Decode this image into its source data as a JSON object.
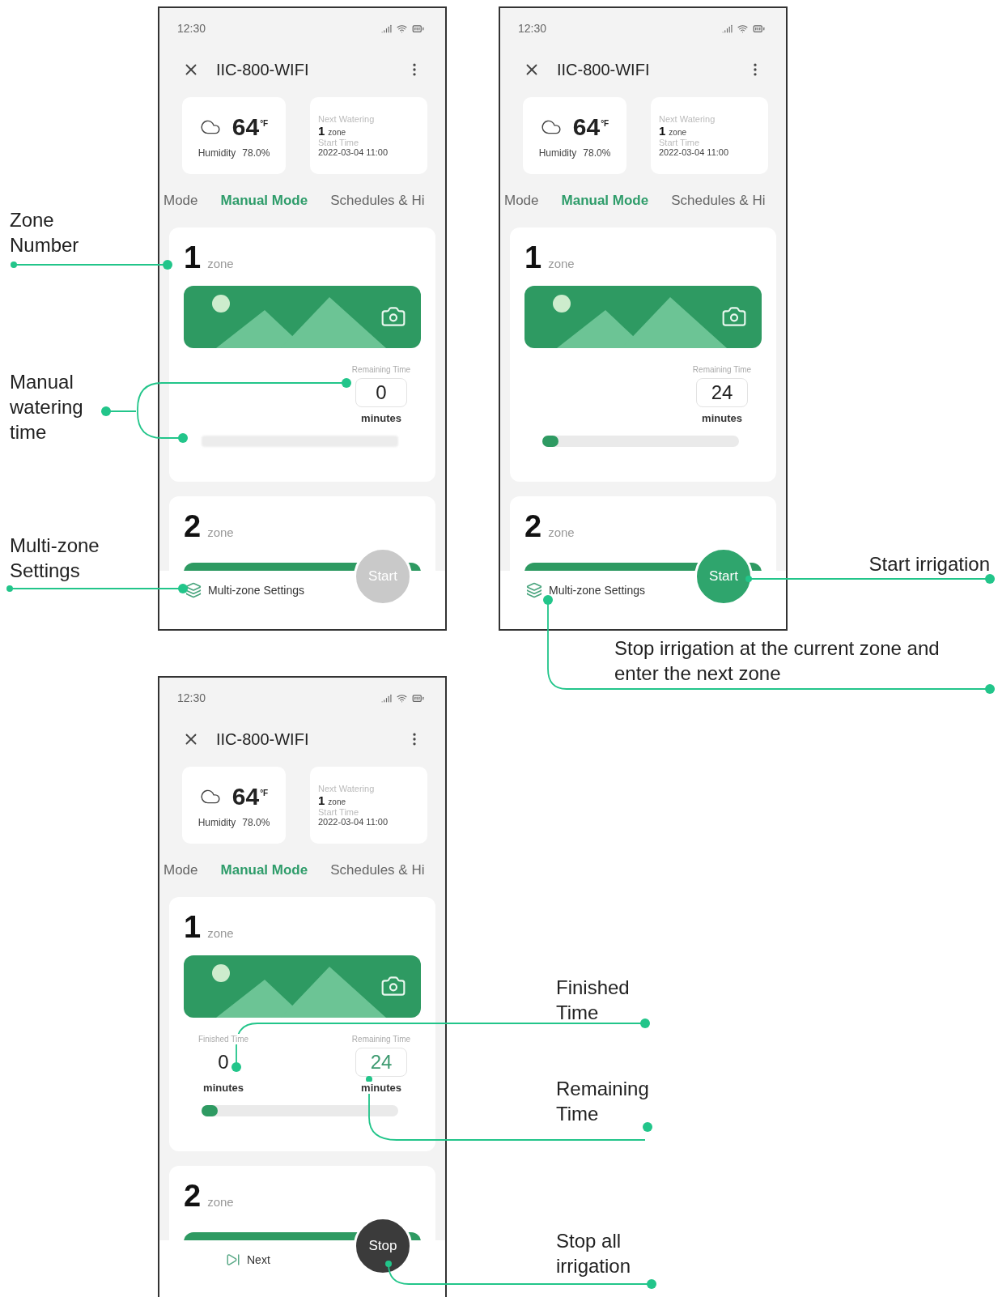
{
  "phones": [
    {
      "status_time": "12:30",
      "title": "IIC-800-WIFI",
      "weather": {
        "temperature": "64",
        "unit": "°F",
        "humidity_label": "Humidity",
        "humidity": "78.0%"
      },
      "next_watering": {
        "label": "Next Watering",
        "zone_number": "1",
        "zone_label": "zone",
        "start_label": "Start Time",
        "start_time": "2022-03-04 11:00"
      },
      "tabs": [
        {
          "label": "Mode",
          "selected": false
        },
        {
          "label": "Manual Mode",
          "selected": true
        },
        {
          "label": "Schedules & Hi",
          "selected": false
        }
      ],
      "zones": [
        {
          "number": "1",
          "label": "zone",
          "remaining": {
            "label": "Remaining Time",
            "value": "0",
            "unit": "minutes",
            "highlighted": false
          },
          "control": {
            "kind": "hint"
          }
        },
        {
          "number": "2",
          "label": "zone"
        }
      ],
      "bottom": {
        "kind": "settings",
        "label": "Multi-zone Settings"
      },
      "action": {
        "label": "Start",
        "kind": "disabled"
      }
    },
    {
      "status_time": "12:30",
      "title": "IIC-800-WIFI",
      "weather": {
        "temperature": "64",
        "unit": "°F",
        "humidity_label": "Humidity",
        "humidity": "78.0%"
      },
      "next_watering": {
        "label": "Next Watering",
        "zone_number": "1",
        "zone_label": "zone",
        "start_label": "Start Time",
        "start_time": "2022-03-04 11:00"
      },
      "tabs": [
        {
          "label": "Mode",
          "selected": false
        },
        {
          "label": "Manual Mode",
          "selected": true
        },
        {
          "label": "Schedules & Hi",
          "selected": false
        }
      ],
      "zones": [
        {
          "number": "1",
          "label": "zone",
          "remaining": {
            "label": "Remaining Time",
            "value": "24",
            "unit": "minutes",
            "highlighted": false
          },
          "control": {
            "kind": "slider",
            "level": 0.04
          }
        },
        {
          "number": "2",
          "label": "zone"
        }
      ],
      "bottom": {
        "kind": "settings",
        "label": "Multi-zone Settings"
      },
      "action": {
        "label": "Start",
        "kind": "ready"
      }
    },
    {
      "status_time": "12:30",
      "title": "IIC-800-WIFI",
      "weather": {
        "temperature": "64",
        "unit": "°F",
        "humidity_label": "Humidity",
        "humidity": "78.0%"
      },
      "next_watering": {
        "label": "Next Watering",
        "zone_number": "1",
        "zone_label": "zone",
        "start_label": "Start Time",
        "start_time": "2022-03-04 11:00"
      },
      "tabs": [
        {
          "label": "Mode",
          "selected": false
        },
        {
          "label": "Manual Mode",
          "selected": true
        },
        {
          "label": "Schedules & Hi",
          "selected": false
        }
      ],
      "zones": [
        {
          "number": "1",
          "label": "zone",
          "finished": {
            "label": "Finished Time",
            "value": "0",
            "unit": "minutes"
          },
          "remaining": {
            "label": "Remaining Time",
            "value": "24",
            "unit": "minutes",
            "highlighted": true
          },
          "control": {
            "kind": "slider",
            "level": 0.04
          }
        },
        {
          "number": "2",
          "label": "zone"
        }
      ],
      "bottom": {
        "kind": "next",
        "label": "Next"
      },
      "action": {
        "label": "Stop",
        "kind": "running"
      }
    }
  ],
  "annotations": [
    {
      "text": "Zone Number"
    },
    {
      "text": "Manual watering time"
    },
    {
      "text": "Multi-zone Settings"
    },
    {
      "text": "Start irrigation"
    },
    {
      "text": "Stop irrigation at the current zone and enter the next zone"
    },
    {
      "text": "Finished Time"
    },
    {
      "text": "Remaining Time"
    },
    {
      "text": "Stop all irrigation"
    }
  ]
}
